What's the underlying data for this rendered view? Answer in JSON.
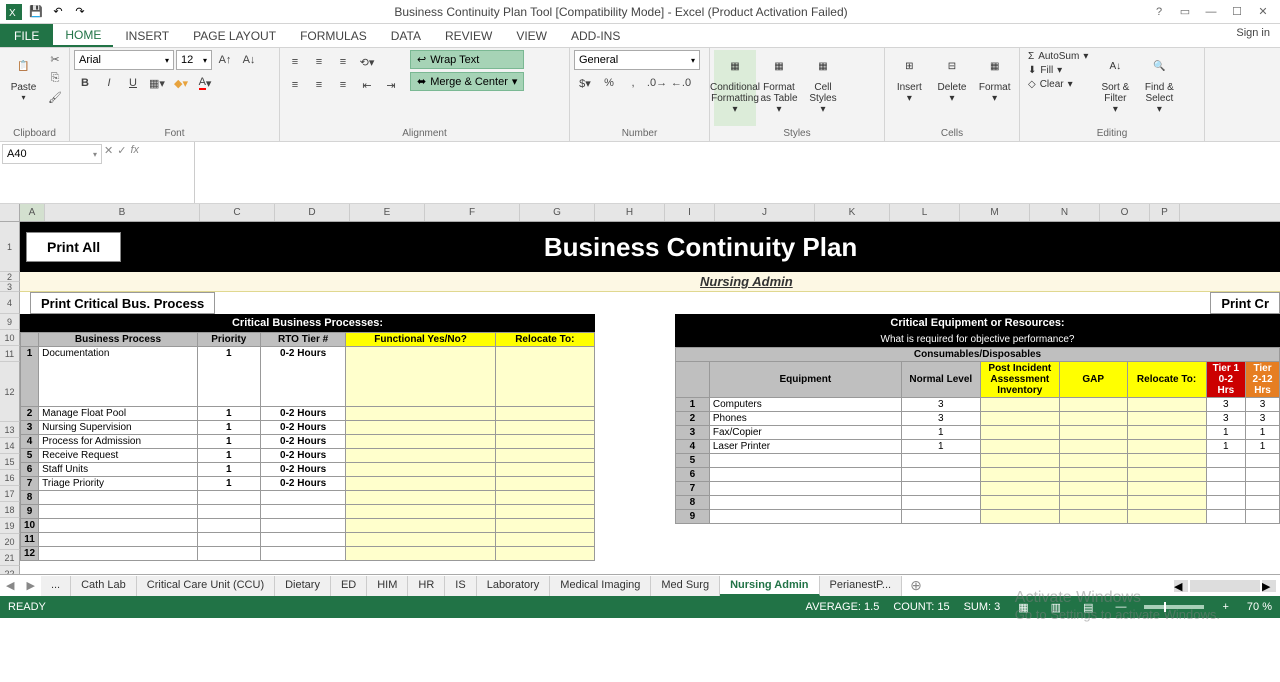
{
  "title": "Business Continuity Plan Tool  [Compatibility Mode] - Excel (Product Activation Failed)",
  "signin": "Sign in",
  "tabs": {
    "file": "FILE",
    "home": "HOME",
    "insert": "INSERT",
    "page": "PAGE LAYOUT",
    "formulas": "FORMULAS",
    "data": "DATA",
    "review": "REVIEW",
    "view": "VIEW",
    "addins": "ADD-INS"
  },
  "ribbon": {
    "clipboard": "Clipboard",
    "paste": "Paste",
    "font": "Font",
    "fontname": "Arial",
    "fontsize": "12",
    "alignment": "Alignment",
    "wrap": "Wrap Text",
    "merge": "Merge & Center",
    "number": "Number",
    "numfmt": "General",
    "styles": "Styles",
    "cond": "Conditional Formatting",
    "fmttable": "Format as Table",
    "cellstyles": "Cell Styles",
    "cells": "Cells",
    "insert": "Insert",
    "delete": "Delete",
    "format": "Format",
    "editing": "Editing",
    "autosum": "AutoSum",
    "fill": "Fill",
    "clear": "Clear",
    "sort": "Sort & Filter",
    "find": "Find & Select"
  },
  "namebox": "A40",
  "cols": [
    "A",
    "B",
    "C",
    "D",
    "E",
    "F",
    "G",
    "H",
    "I",
    "J",
    "K",
    "L",
    "M",
    "N",
    "O",
    "P"
  ],
  "banner": {
    "printall": "Print All",
    "title": "Business Continuity Plan",
    "subtitle": "Nursing Admin"
  },
  "left": {
    "btn": "Print Critical Bus. Process",
    "title": "Critical Business Processes:",
    "headers": [
      "Business Process",
      "Priority",
      "RTO Tier #",
      "Functional Yes/No?",
      "Relocate To:"
    ],
    "rows": [
      {
        "n": "1",
        "name": "Documentation",
        "prio": "1",
        "rto": "0-2 Hours"
      },
      {
        "n": "2",
        "name": "Manage Float Pool",
        "prio": "1",
        "rto": "0-2 Hours"
      },
      {
        "n": "3",
        "name": "Nursing Supervision",
        "prio": "1",
        "rto": "0-2 Hours"
      },
      {
        "n": "4",
        "name": "Process for Admission",
        "prio": "1",
        "rto": "0-2 Hours"
      },
      {
        "n": "5",
        "name": "Receive Request",
        "prio": "1",
        "rto": "0-2 Hours"
      },
      {
        "n": "6",
        "name": "Staff Units",
        "prio": "1",
        "rto": "0-2 Hours"
      },
      {
        "n": "7",
        "name": "Triage Priority",
        "prio": "1",
        "rto": "0-2 Hours"
      },
      {
        "n": "8"
      },
      {
        "n": "9"
      },
      {
        "n": "10"
      },
      {
        "n": "11"
      },
      {
        "n": "12"
      }
    ]
  },
  "right": {
    "btn": "Print Cr",
    "title": "Critical Equipment or Resources:",
    "req": "What is required for objective performance?",
    "consum": "Consumables/Disposables",
    "headers": {
      "equip": "Equipment",
      "normal": "Normal Level",
      "post": "Post Incident Assessment Inventory",
      "gap": "GAP",
      "reloc": "Relocate To:",
      "t1": "Tier 1 0-2 Hrs",
      "t2": "Tier 2-12 Hrs"
    },
    "rows": [
      {
        "n": "1",
        "name": "Computers",
        "lvl": "3",
        "t1": "3",
        "t2": "3"
      },
      {
        "n": "2",
        "name": "Phones",
        "lvl": "3",
        "t1": "3",
        "t2": "3"
      },
      {
        "n": "3",
        "name": "Fax/Copier",
        "lvl": "1",
        "t1": "1",
        "t2": "1"
      },
      {
        "n": "4",
        "name": "Laser Printer",
        "lvl": "1",
        "t1": "1",
        "t2": "1"
      },
      {
        "n": "5"
      },
      {
        "n": "6"
      },
      {
        "n": "7"
      },
      {
        "n": "8"
      },
      {
        "n": "9"
      }
    ]
  },
  "sheets": [
    "...",
    "Cath Lab",
    "Critical Care Unit (CCU)",
    "Dietary",
    "ED",
    "HIM",
    "HR",
    "IS",
    "Laboratory",
    "Medical Imaging",
    "Med Surg",
    "Nursing Admin",
    "PerianestP..."
  ],
  "active_sheet": "Nursing Admin",
  "status": {
    "ready": "READY",
    "avg": "AVERAGE: 1.5",
    "count": "COUNT: 15",
    "sum": "SUM: 3",
    "zoom": "70 %"
  },
  "watermark": {
    "l1": "Activate Windows",
    "l2": "Go to Settings to activate Windows."
  }
}
